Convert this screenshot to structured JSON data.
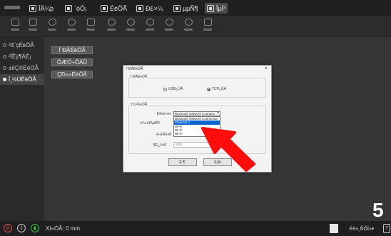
{
  "menu": {
    "items": [
      {
        "label": "ÎÄ¼þ"
      },
      {
        "label": "´òÓ¡"
      },
      {
        "label": "ÉèÖÃ"
      },
      {
        "label": "Ð£×¼"
      },
      {
        "label": "µµÑ¶"
      },
      {
        "label": "ÏµÍ³"
      }
    ]
  },
  "sidebar": {
    "items": [
      {
        "label": "³ß´çÉèÖÃ"
      },
      {
        "label": "²ÎÊý¶ÁÈ¡"
      },
      {
        "label": "±êÇ©ÉèÖÃ"
      },
      {
        "label": "Ï¸½ÚÉèÖÃ"
      }
    ]
  },
  "main": {
    "buttons": [
      {
        "label": "Í¨ÐÅÉèÖÃ"
      },
      {
        "label": "ÖÆÓ÷ÔÀÛ"
      },
      {
        "label": "ÇÐ»»ÉèÖÃ"
      }
    ]
  },
  "dialog": {
    "title": "Í¨ÐÅÉèÖÃ",
    "close": "×",
    "group1_label": "Í¨ÐÅÉèÖÃ",
    "radio_usb": "USB¿ÚÁ",
    "radio_tcp": "TCP¿ÚÁ",
    "group2_label": "TCPÉèÖÃ",
    "ethernet_label": "Ethernet",
    "select_value": "Bluetooth Network Connecti",
    "dropdown_options": [
      "Bluetooth Network Connection",
      "Ethernet 3",
      "Wi-Fi",
      "Wi-Fi",
      "Wi-Fi"
    ],
    "ip_label": "±¾»úIPµØÖ·",
    "gateway_label": "Ä¬ÈÏÍø¹Ø",
    "port_label": "¶Ë¿ÚºÅ",
    "port_value": "5001",
    "ok_label": "È·¶¨",
    "cancel_label": "È¡Ïû"
  },
  "status": {
    "position_text": "Xì»ÒÃ: 0 mm",
    "combo_label": "Éè±¸ÑÕÎ»",
    "help": "?"
  },
  "overlay": {
    "step_number": "5"
  },
  "colors": {
    "arrow": "#ff0d0d",
    "dropdown_highlight": "#0a64d0"
  }
}
